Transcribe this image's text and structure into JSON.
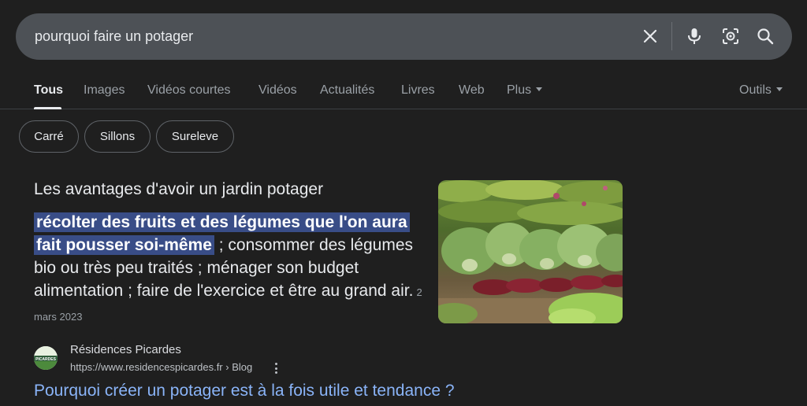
{
  "search": {
    "query": "pourquoi faire un potager"
  },
  "tabs": [
    {
      "label": "Tous"
    },
    {
      "label": "Images"
    },
    {
      "label": "Vidéos courtes"
    },
    {
      "label": "Vidéos"
    },
    {
      "label": "Actualités"
    },
    {
      "label": "Livres"
    },
    {
      "label": "Web"
    },
    {
      "label": "Plus"
    }
  ],
  "tools_label": "Outils",
  "chips": [
    {
      "label": "Carré"
    },
    {
      "label": "Sillons"
    },
    {
      "label": "Sureleve"
    }
  ],
  "snippet": {
    "title": "Les avantages d'avoir un jardin potager",
    "highlight": "récolter des fruits et des légumes que l'on aura fait pousser soi-même",
    "body": " ; consommer des légumes bio ou très peu traités ; ménager son budget alimentation ; faire de l'exercice et être au grand air.",
    "date": "2 mars 2023"
  },
  "result": {
    "favicon_text": "PICARDES",
    "site_name": "Résidences Picardes",
    "url": "https://www.residencespicardes.fr › Blog",
    "title": "Pourquoi créer un potager est à la fois utile et tendance ?"
  },
  "colors": {
    "background": "#1f1f1f",
    "search_bar": "#4d5156",
    "highlight": "#394d87",
    "link": "#8ab4f8"
  }
}
